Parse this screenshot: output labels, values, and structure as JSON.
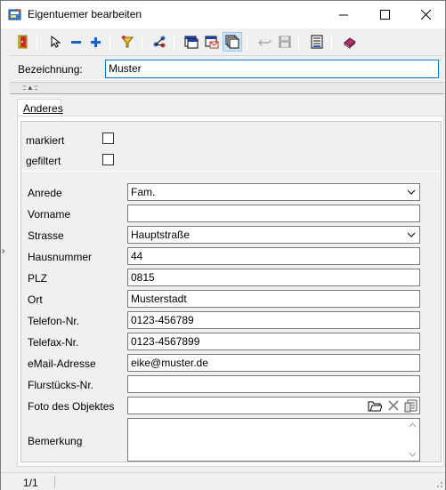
{
  "window": {
    "title": "Eigentuemer bearbeiten"
  },
  "toolbar": {
    "icons": [
      "exit-icon",
      "pointer-icon",
      "minus-icon",
      "plus-icon",
      "filter-icon",
      "network-icon",
      "window-icon",
      "window-mail-icon",
      "window-stack-icon",
      "undo-icon",
      "save-icon",
      "list-icon",
      "book-icon"
    ]
  },
  "header": {
    "bezeichnung_label": "Bezeichnung:",
    "bezeichnung_value": "Muster"
  },
  "tab": {
    "label": "Anderes"
  },
  "flags": {
    "markiert_label": "markiert",
    "gefiltert_label": "gefiltert"
  },
  "form": {
    "anrede_label": "Anrede",
    "anrede_value": "Fam.",
    "vorname_label": "Vorname",
    "vorname_value": "",
    "strasse_label": "Strasse",
    "strasse_value": "Hauptstraße",
    "hausnummer_label": "Hausnummer",
    "hausnummer_value": "44",
    "plz_label": "PLZ",
    "plz_value": "0815",
    "ort_label": "Ort",
    "ort_value": "Musterstadt",
    "telefon_label": "Telefon-Nr.",
    "telefon_value": "0123-456789",
    "telefax_label": "Telefax-Nr.",
    "telefax_value": "0123-4567899",
    "email_label": "eMail-Adresse",
    "email_value": "eike@muster.de",
    "flurstueck_label": "Flurstücks-Nr.",
    "flurstueck_value": "",
    "foto_label": "Foto des Objektes",
    "foto_value": "",
    "bemerkung_label": "Bemerkung",
    "bemerkung_value": ""
  },
  "status": {
    "record": "1/1"
  },
  "colors": {
    "accent": "#0078d7",
    "tab_active": "#ffffff",
    "toolbar_active": "#cce4f7"
  }
}
